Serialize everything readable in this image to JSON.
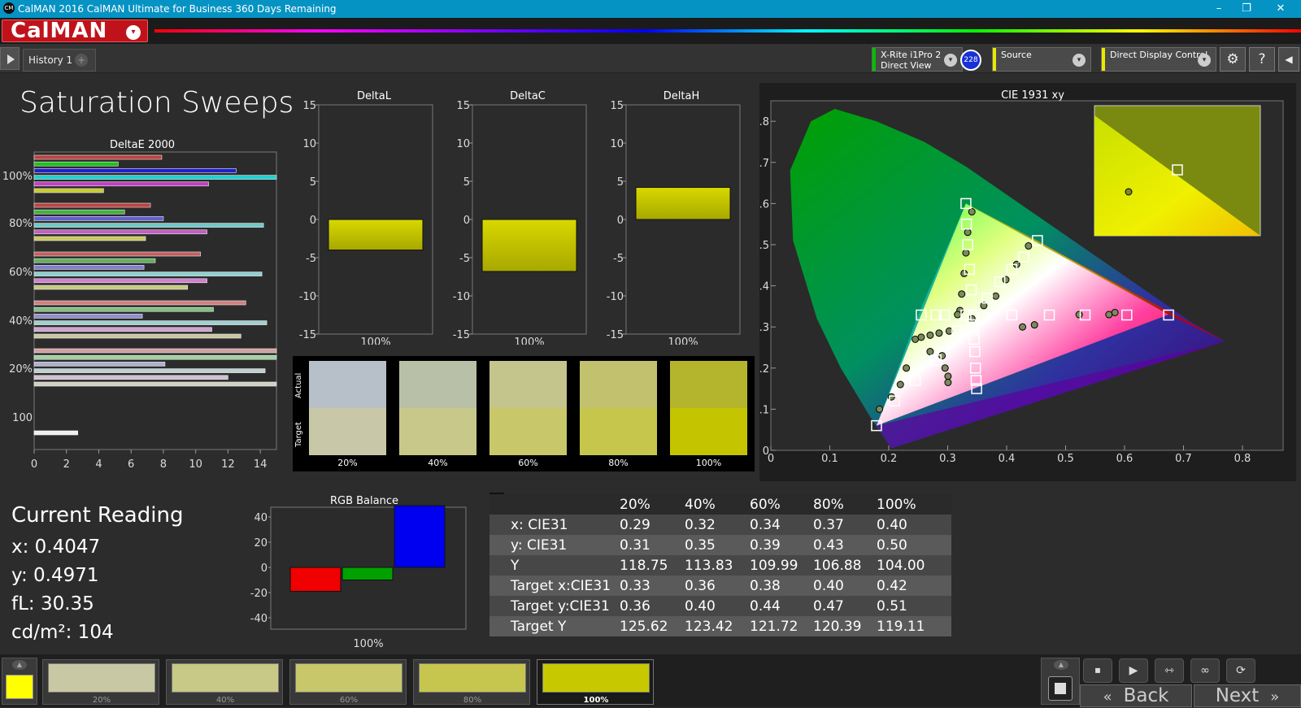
{
  "window": {
    "title": "CalMAN 2016 CalMAN Ultimate for Business 360 Days Remaining",
    "app_icon": "CM",
    "min": "–",
    "restore": "❐",
    "close": "✕"
  },
  "menu": {
    "logo": "CalMAN",
    "logo_caret": "▾"
  },
  "tabs": {
    "history": "History 1",
    "add": "+"
  },
  "devices": {
    "meter": {
      "line1": "X-Rite i1Pro 2",
      "line2": "Direct View",
      "stripe": "#00c000"
    },
    "badge": "228",
    "source": {
      "label": "Source",
      "stripe": "#e8e800"
    },
    "display": {
      "label": "Direct Display Control",
      "stripe": "#e8e800"
    },
    "caret": "▾"
  },
  "toolbar_icons": {
    "settings": "⚙",
    "help": "?",
    "collapse": "◀"
  },
  "page": {
    "title": "Saturation Sweeps"
  },
  "deltae_chart": {
    "title": "DeltaE 2000",
    "y_labels": [
      "100%",
      "80%",
      "60%",
      "40%",
      "20%",
      "100"
    ],
    "x_ticks": [
      "0",
      "2",
      "4",
      "6",
      "8",
      "10",
      "12",
      "14"
    ]
  },
  "delta_charts": [
    {
      "title": "DeltaL",
      "value": -4.0,
      "xlabel": "100%"
    },
    {
      "title": "DeltaC",
      "value": -6.8,
      "xlabel": "100%"
    },
    {
      "title": "DeltaH",
      "value": 4.2,
      "xlabel": "100%"
    }
  ],
  "delta_yticks": [
    "15",
    "10",
    "5",
    "0",
    "-5",
    "-10",
    "-15"
  ],
  "swatches": {
    "actual_label": "Actual",
    "target_label": "Target",
    "items": [
      {
        "label": "20%",
        "actual": "#b7c0c8",
        "target": "#c8c8a9"
      },
      {
        "label": "40%",
        "actual": "#b8c0a8",
        "target": "#c8c88a"
      },
      {
        "label": "60%",
        "actual": "#c4c58c",
        "target": "#c8c86b"
      },
      {
        "label": "80%",
        "actual": "#c2c26e",
        "target": "#c6c64c"
      },
      {
        "label": "100%",
        "actual": "#b5b52d",
        "target": "#c4c400"
      }
    ]
  },
  "cie": {
    "title": "CIE 1931 xy",
    "y_ticks": [
      "0.8",
      "0.7",
      "0.6",
      "0.5",
      "0.4",
      "0.3",
      "0.2",
      "0.1",
      "0"
    ],
    "x_ticks": [
      "0",
      "0.1",
      "0.2",
      "0.3",
      "0.4",
      "0.5",
      "0.6",
      "0.7",
      "0.8"
    ],
    "targets": [
      [
        0.3,
        0.6
      ],
      [
        0.301,
        0.55
      ],
      [
        0.303,
        0.5
      ],
      [
        0.306,
        0.44
      ],
      [
        0.309,
        0.39
      ],
      [
        0.3127,
        0.329
      ],
      [
        0.3,
        0.329
      ],
      [
        0.264,
        0.329
      ],
      [
        0.25,
        0.329
      ],
      [
        0.225,
        0.329
      ],
      [
        0.377,
        0.329
      ],
      [
        0.44,
        0.329
      ],
      [
        0.5,
        0.329
      ],
      [
        0.57,
        0.329
      ],
      [
        0.64,
        0.329
      ],
      [
        0.42,
        0.51
      ],
      [
        0.397,
        0.47
      ],
      [
        0.377,
        0.44
      ],
      [
        0.357,
        0.41
      ],
      [
        0.336,
        0.37
      ],
      [
        0.313,
        0.3
      ],
      [
        0.314,
        0.27
      ],
      [
        0.315,
        0.24
      ],
      [
        0.316,
        0.2
      ],
      [
        0.317,
        0.17
      ],
      [
        0.318,
        0.15
      ],
      [
        0.285,
        0.29
      ],
      [
        0.25,
        0.22
      ],
      [
        0.215,
        0.17
      ],
      [
        0.18,
        0.12
      ],
      [
        0.15,
        0.06
      ]
    ],
    "readings": [
      [
        0.31,
        0.58
      ],
      [
        0.303,
        0.53
      ],
      [
        0.3,
        0.48
      ],
      [
        0.297,
        0.43
      ],
      [
        0.293,
        0.38
      ],
      [
        0.29,
        0.34
      ],
      [
        0.286,
        0.33
      ],
      [
        0.405,
        0.497
      ],
      [
        0.385,
        0.452
      ],
      [
        0.367,
        0.415
      ],
      [
        0.35,
        0.375
      ],
      [
        0.33,
        0.352
      ],
      [
        0.31,
        0.32
      ],
      [
        0.395,
        0.3
      ],
      [
        0.415,
        0.305
      ],
      [
        0.49,
        0.33
      ],
      [
        0.55,
        0.335
      ],
      [
        0.54,
        0.33
      ],
      [
        0.215,
        0.27
      ],
      [
        0.225,
        0.275
      ],
      [
        0.24,
        0.28
      ],
      [
        0.255,
        0.285
      ],
      [
        0.272,
        0.29
      ],
      [
        0.26,
        0.23
      ],
      [
        0.265,
        0.2
      ],
      [
        0.27,
        0.18
      ],
      [
        0.27,
        0.165
      ],
      [
        0.24,
        0.24
      ],
      [
        0.2,
        0.2
      ],
      [
        0.19,
        0.16
      ],
      [
        0.175,
        0.13
      ],
      [
        0.155,
        0.1
      ]
    ],
    "inset_point_actual": [
      0.405,
      0.497
    ],
    "inset_point_target": [
      0.42,
      0.51
    ]
  },
  "current_reading": {
    "title": "Current Reading",
    "x": "x: 0.4047",
    "y": "y: 0.4971",
    "fl": "fL: 30.35",
    "cd": "cd/m²: 104"
  },
  "rgb_chart": {
    "title": "RGB Balance",
    "y_ticks": [
      "40",
      "20",
      "0",
      "-20",
      "-40"
    ],
    "xlabel": "100%",
    "bars": [
      {
        "name": "Red",
        "value": -19,
        "color": "#f00000"
      },
      {
        "name": "Green",
        "value": -10,
        "color": "#00a000"
      },
      {
        "name": "Blue",
        "value": 49,
        "color": "#0000f0"
      }
    ]
  },
  "table": {
    "columns": [
      "20%",
      "40%",
      "60%",
      "80%",
      "100%"
    ],
    "rows": [
      {
        "label": "x: CIE31",
        "values": [
          "0.29",
          "0.32",
          "0.34",
          "0.37",
          "0.40"
        ]
      },
      {
        "label": "y: CIE31",
        "values": [
          "0.31",
          "0.35",
          "0.39",
          "0.43",
          "0.50"
        ]
      },
      {
        "label": "Y",
        "values": [
          "118.75",
          "113.83",
          "109.99",
          "106.88",
          "104.00"
        ]
      },
      {
        "label": "Target x:CIE31",
        "values": [
          "0.33",
          "0.36",
          "0.38",
          "0.40",
          "0.42"
        ]
      },
      {
        "label": "Target y:CIE31",
        "values": [
          "0.36",
          "0.40",
          "0.44",
          "0.47",
          "0.51"
        ]
      },
      {
        "label": "Target Y",
        "values": [
          "125.62",
          "123.42",
          "121.72",
          "120.39",
          "119.11"
        ]
      }
    ]
  },
  "bottom": {
    "current_color": "#ffff00",
    "up_icon": "▲",
    "tiles": [
      {
        "label": "20%",
        "color": "#c8c8a4"
      },
      {
        "label": "40%",
        "color": "#c8c887"
      },
      {
        "label": "60%",
        "color": "#c8c86b"
      },
      {
        "label": "80%",
        "color": "#c6c64e"
      },
      {
        "label": "100%",
        "color": "#c8c800"
      }
    ],
    "controls": [
      "⏹",
      "▶",
      "⇿",
      "∞",
      "⟳"
    ],
    "back": "Back",
    "next": "Next",
    "back_icon": "«",
    "next_icon": "»"
  }
}
